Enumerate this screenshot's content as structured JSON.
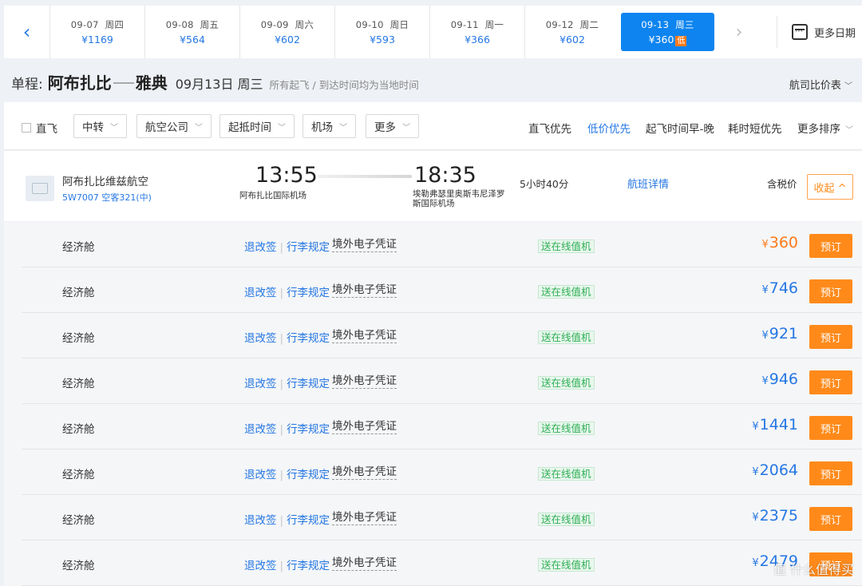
{
  "datebar": {
    "dates": [
      {
        "date": "09-07",
        "weekday": "周四",
        "price": "¥1169"
      },
      {
        "date": "09-08",
        "weekday": "周五",
        "price": "¥564"
      },
      {
        "date": "09-09",
        "weekday": "周六",
        "price": "¥602"
      },
      {
        "date": "09-10",
        "weekday": "周日",
        "price": "¥593"
      },
      {
        "date": "09-11",
        "weekday": "周一",
        "price": "¥366"
      },
      {
        "date": "09-12",
        "weekday": "周二",
        "price": "¥602"
      },
      {
        "date": "09-13",
        "weekday": "周三",
        "price": "¥360",
        "badge": "低"
      }
    ],
    "more_dates_label": "更多日期"
  },
  "route": {
    "type_label": "单程:",
    "from_city": "阿布扎比",
    "to_city": "雅典",
    "date": "09月13日 周三",
    "note": "所有起飞 / 到达时间均为当地时间",
    "compare_label": "航司比价表"
  },
  "filters": {
    "direct_label": "直飞",
    "dropdowns": [
      "中转",
      "航空公司",
      "起抵时间",
      "机场",
      "更多"
    ],
    "sorts": [
      "直飞优先",
      "低价优先",
      "起飞时间早-晚",
      "耗时短优先",
      "更多排序"
    ]
  },
  "flight": {
    "airline": "阿布扎比维兹航空",
    "flight_no": "5W7007 空客321(中)",
    "dep_time": "13:55",
    "dep_airport": "阿布扎比国际机场",
    "arr_time": "18:35",
    "arr_airport": "埃勒弗瑟里奥斯韦尼泽罗斯国际机场",
    "duration": "5小时40分",
    "details_link": "航班详情",
    "tax_label": "含税价",
    "collapse_label": "收起 ^"
  },
  "fares": [
    {
      "cabin": "经济舱",
      "refund": "退改签",
      "baggage": "行李规定",
      "voucher": "境外电子凭证",
      "checkin": "送在线值机",
      "price": "360",
      "book": "预订"
    },
    {
      "cabin": "经济舱",
      "refund": "退改签",
      "baggage": "行李规定",
      "voucher": "境外电子凭证",
      "checkin": "送在线值机",
      "price": "746",
      "book": "预订"
    },
    {
      "cabin": "经济舱",
      "refund": "退改签",
      "baggage": "行李规定",
      "voucher": "境外电子凭证",
      "checkin": "送在线值机",
      "price": "921",
      "book": "预订"
    },
    {
      "cabin": "经济舱",
      "refund": "退改签",
      "baggage": "行李规定",
      "voucher": "境外电子凭证",
      "checkin": "送在线值机",
      "price": "946",
      "book": "预订"
    },
    {
      "cabin": "经济舱",
      "refund": "退改签",
      "baggage": "行李规定",
      "voucher": "境外电子凭证",
      "checkin": "送在线值机",
      "price": "1441",
      "book": "预订"
    },
    {
      "cabin": "经济舱",
      "refund": "退改签",
      "baggage": "行李规定",
      "voucher": "境外电子凭证",
      "checkin": "送在线值机",
      "price": "2064",
      "book": "预订"
    },
    {
      "cabin": "经济舱",
      "refund": "退改签",
      "baggage": "行李规定",
      "voucher": "境外电子凭证",
      "checkin": "送在线值机",
      "price": "2375",
      "book": "预订"
    },
    {
      "cabin": "经济舱",
      "refund": "退改签",
      "baggage": "行李规定",
      "voucher": "境外电子凭证",
      "checkin": "送在线值机",
      "price": "2479",
      "book": "预订"
    }
  ],
  "currency": "¥",
  "watermark": "值 什么值得买",
  "colors": {
    "accent": "#2577e3",
    "active_date": "#0d84f0",
    "orange": "#ff8a1a",
    "green": "#2cae52"
  }
}
